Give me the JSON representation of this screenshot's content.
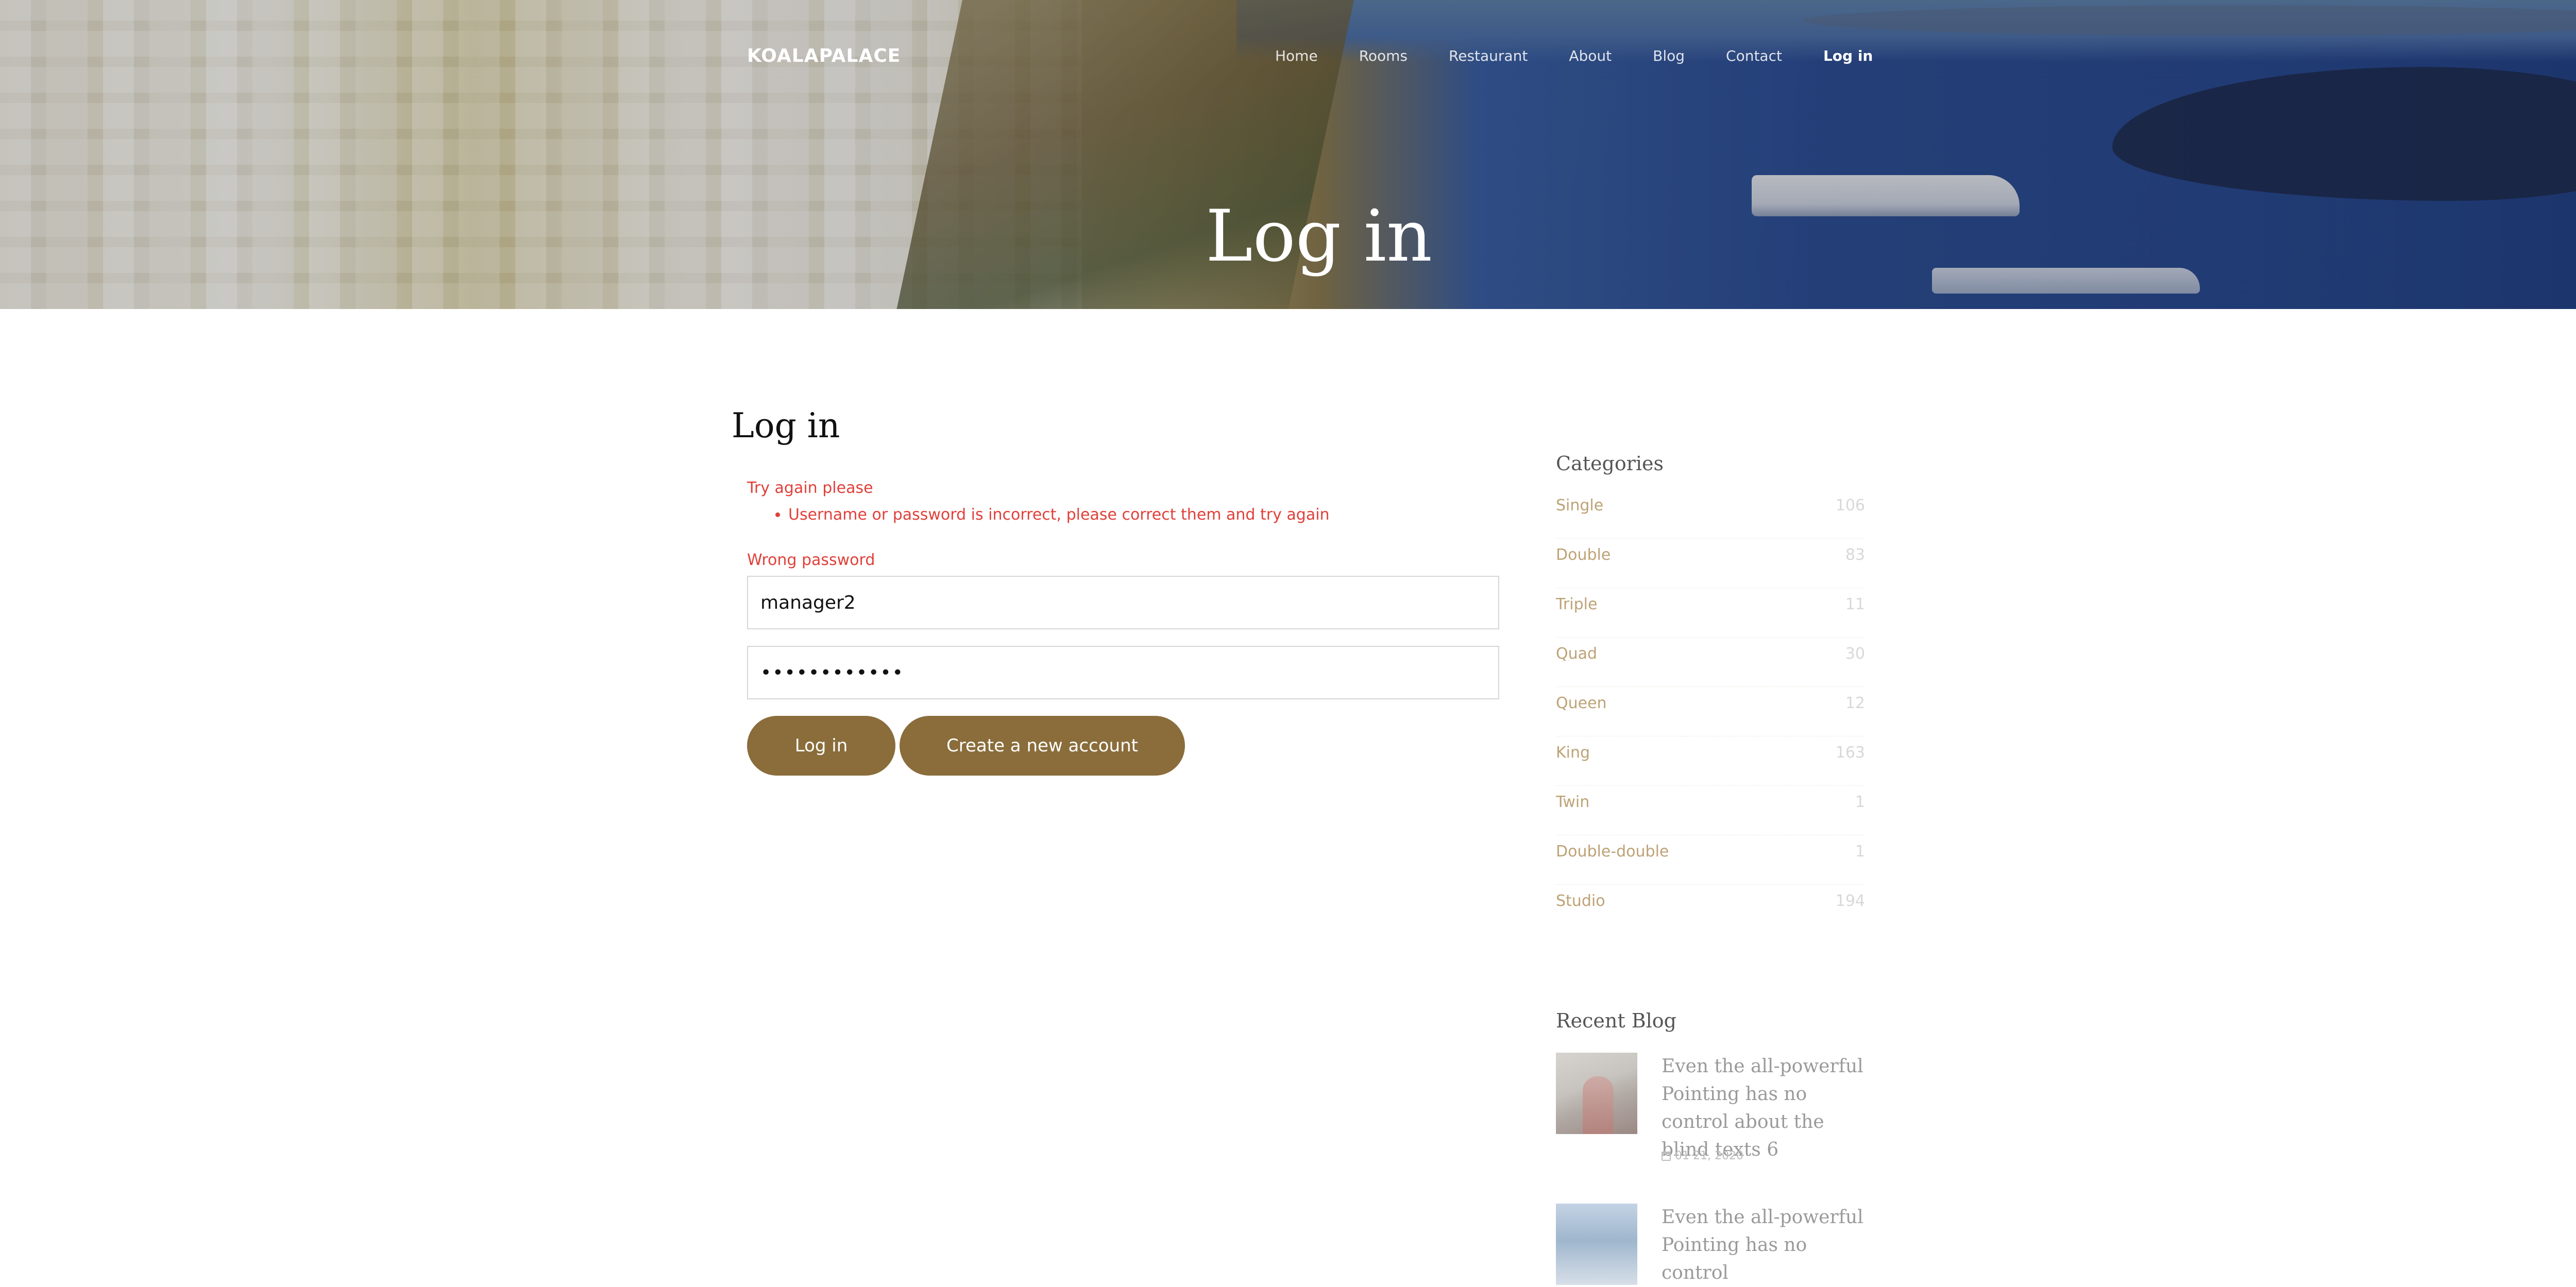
{
  "header": {
    "brand": "KOALAPALACE",
    "nav": [
      {
        "label": "Home"
      },
      {
        "label": "Rooms"
      },
      {
        "label": "Restaurant"
      },
      {
        "label": "About"
      },
      {
        "label": "Blog"
      },
      {
        "label": "Contact"
      },
      {
        "label": "Log in",
        "active": true
      }
    ],
    "hero_title": "Log in"
  },
  "login": {
    "title": "Log in",
    "error_heading": "Try again please",
    "errors": [
      "Username or password is incorrect, please correct them and try again"
    ],
    "field_error": "Wrong password",
    "username_value": "manager2",
    "password_value": "••••••••••••",
    "login_button": "Log in",
    "create_account_button": "Create a new account"
  },
  "sidebar": {
    "categories_title": "Categories",
    "categories": [
      {
        "name": "Single",
        "count": "106"
      },
      {
        "name": "Double",
        "count": "83"
      },
      {
        "name": "Triple",
        "count": "11"
      },
      {
        "name": "Quad",
        "count": "30"
      },
      {
        "name": "Queen",
        "count": "12"
      },
      {
        "name": "King",
        "count": "163"
      },
      {
        "name": "Twin",
        "count": "1"
      },
      {
        "name": "Double-double",
        "count": "1"
      },
      {
        "name": "Studio",
        "count": "194"
      }
    ],
    "recent_blog_title": "Recent Blog",
    "recent_posts": [
      {
        "title": "Even the all-powerful Pointing has no control about the blind texts 6",
        "date": "01 21, 2020",
        "date_icon": "calendar-icon"
      },
      {
        "title": "Even the all-powerful Pointing has no control",
        "date": "",
        "date_icon": "calendar-icon"
      }
    ]
  },
  "colors": {
    "accent": "#8a6d3b",
    "error": "#e0403a",
    "category_text": "#bda276"
  }
}
